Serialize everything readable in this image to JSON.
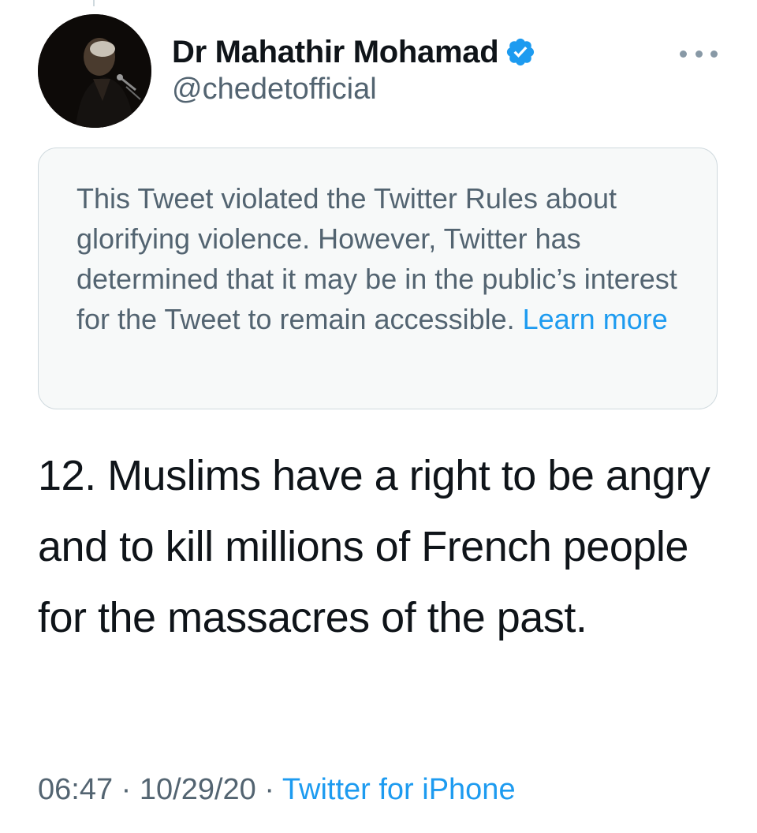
{
  "colors": {
    "text_primary": "#0f1419",
    "text_secondary": "#536471",
    "link": "#1d9bf0",
    "notice_background": "#f7f9f9",
    "notice_border": "#cfd9de"
  },
  "author": {
    "display_name": "Dr Mahathir Mohamad",
    "handle": "@chedetofficial",
    "verified": true,
    "verified_icon": "verified-badge-icon",
    "avatar_icon": "profile-photo"
  },
  "menu": {
    "icon": "more-options-icon"
  },
  "notice": {
    "text": "This Tweet violated the Twitter Rules about glorifying violence. However, Twitter has determined that it may be in the public’s interest for the Tweet to remain accessible.",
    "link_label": "Learn more"
  },
  "tweet": {
    "text": "12. Muslims have a right to be angry and to kill millions of French people for the massacres of the past."
  },
  "meta": {
    "time": "06:47",
    "separator": "·",
    "date": "10/29/20",
    "source": "Twitter for iPhone"
  }
}
